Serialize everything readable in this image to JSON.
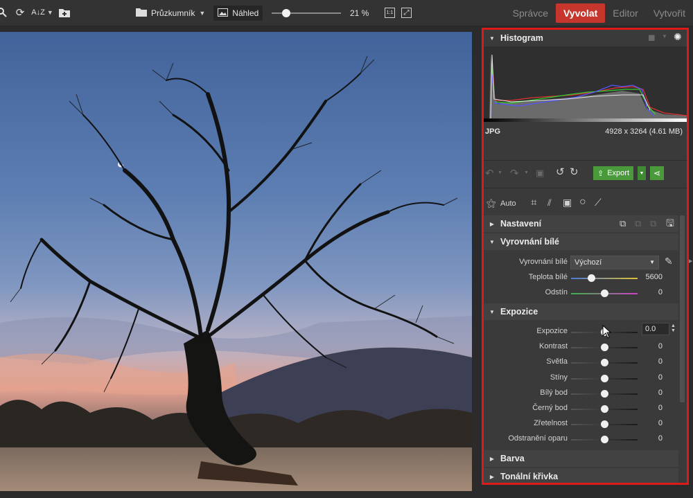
{
  "toolbar": {
    "left_icons": [
      "search-icon",
      "refresh-icon",
      "sort-icon",
      "add-folder-icon"
    ],
    "sort_label": "A↓Z",
    "browser_label": "Průzkumník",
    "preview_label": "Náhled",
    "zoom_value": "21 %",
    "zoom_fraction": 0.15,
    "one_to_one_label": "1:1"
  },
  "modes": [
    {
      "label": "Správce",
      "active": false
    },
    {
      "label": "Vyvolat",
      "active": true
    },
    {
      "label": "Editor",
      "active": false
    },
    {
      "label": "Vytvořit",
      "active": false
    }
  ],
  "histogram": {
    "title": "Histogram",
    "file_type": "JPG",
    "dimensions": "4928 x 3264 (4.61 MB)"
  },
  "actions": {
    "export_label": "Export",
    "auto_label": "Auto"
  },
  "sections": {
    "nastaveni": "Nastavení",
    "white_balance": "Vyrovnání bílé",
    "exposure": "Expozice",
    "color": "Barva",
    "tone_curve": "Tonální křivka"
  },
  "white_balance": {
    "preset_label": "Vyrovnání bílé",
    "preset_value": "Výchozí",
    "temp_label": "Teplota bílé",
    "temp_value": "5600",
    "temp_fraction": 0.3,
    "tint_label": "Odstín",
    "tint_value": "0",
    "tint_fraction": 0.5
  },
  "exposure": {
    "rows": [
      {
        "label": "Expozice",
        "value": "0.0",
        "fraction": 0.5
      },
      {
        "label": "Kontrast",
        "value": "0",
        "fraction": 0.5
      },
      {
        "label": "Světla",
        "value": "0",
        "fraction": 0.5
      },
      {
        "label": "Stíny",
        "value": "0",
        "fraction": 0.5
      },
      {
        "label": "Bílý bod",
        "value": "0",
        "fraction": 0.5
      },
      {
        "label": "Černý bod",
        "value": "0",
        "fraction": 0.5
      },
      {
        "label": "Zřetelnost",
        "value": "0",
        "fraction": 0.5
      },
      {
        "label": "Odstranění oparu",
        "value": "0",
        "fraction": 0.5
      }
    ]
  },
  "colors": {
    "accent": "#c7362c",
    "highlight_border": "#dd1a1a",
    "export_green": "#4a9a3c"
  }
}
